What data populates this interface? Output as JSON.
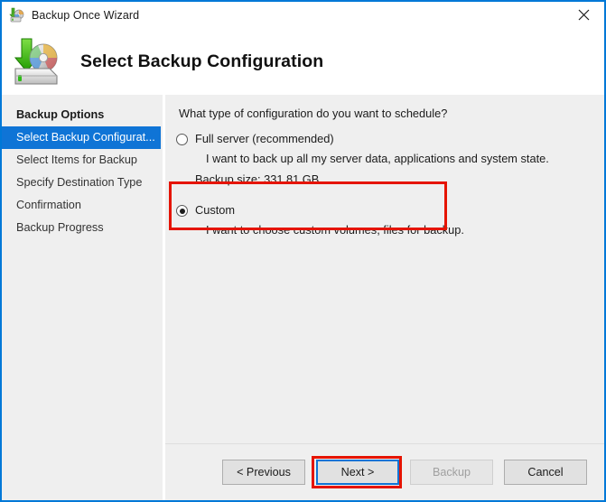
{
  "window": {
    "title": "Backup Once Wizard",
    "title_icon": "backup-wizard-icon",
    "close_icon": "close-icon",
    "accent_color": "#0078d7"
  },
  "header": {
    "title": "Select Backup Configuration",
    "icon": "backup-disk-arrow-icon"
  },
  "sidebar": {
    "items": [
      {
        "label": "Backup Options",
        "state": "completed"
      },
      {
        "label": "Select Backup Configurat...",
        "state": "selected"
      },
      {
        "label": "Select Items for Backup",
        "state": "upcoming"
      },
      {
        "label": "Specify Destination Type",
        "state": "upcoming"
      },
      {
        "label": "Confirmation",
        "state": "upcoming"
      },
      {
        "label": "Backup Progress",
        "state": "upcoming"
      }
    ],
    "selected_color": "#0f74d6"
  },
  "main": {
    "question": "What type of configuration do you want to schedule?",
    "options": [
      {
        "label": "Full server (recommended)",
        "description": "I want to back up all my server data, applications and system state.",
        "size_label": "Backup size: 331.81 GB",
        "checked": false
      },
      {
        "label": "Custom",
        "description": "I want to choose custom volumes, files for backup.",
        "checked": true,
        "annotated": true
      }
    ]
  },
  "footer": {
    "buttons": [
      {
        "label": "< Previous",
        "state": "enabled"
      },
      {
        "label": "Next >",
        "state": "default",
        "annotated": true
      },
      {
        "label": "Backup",
        "state": "disabled"
      },
      {
        "label": "Cancel",
        "state": "enabled"
      }
    ]
  },
  "annotations": {
    "color": "#e51400",
    "targets": [
      "custom-option",
      "next-button"
    ]
  }
}
